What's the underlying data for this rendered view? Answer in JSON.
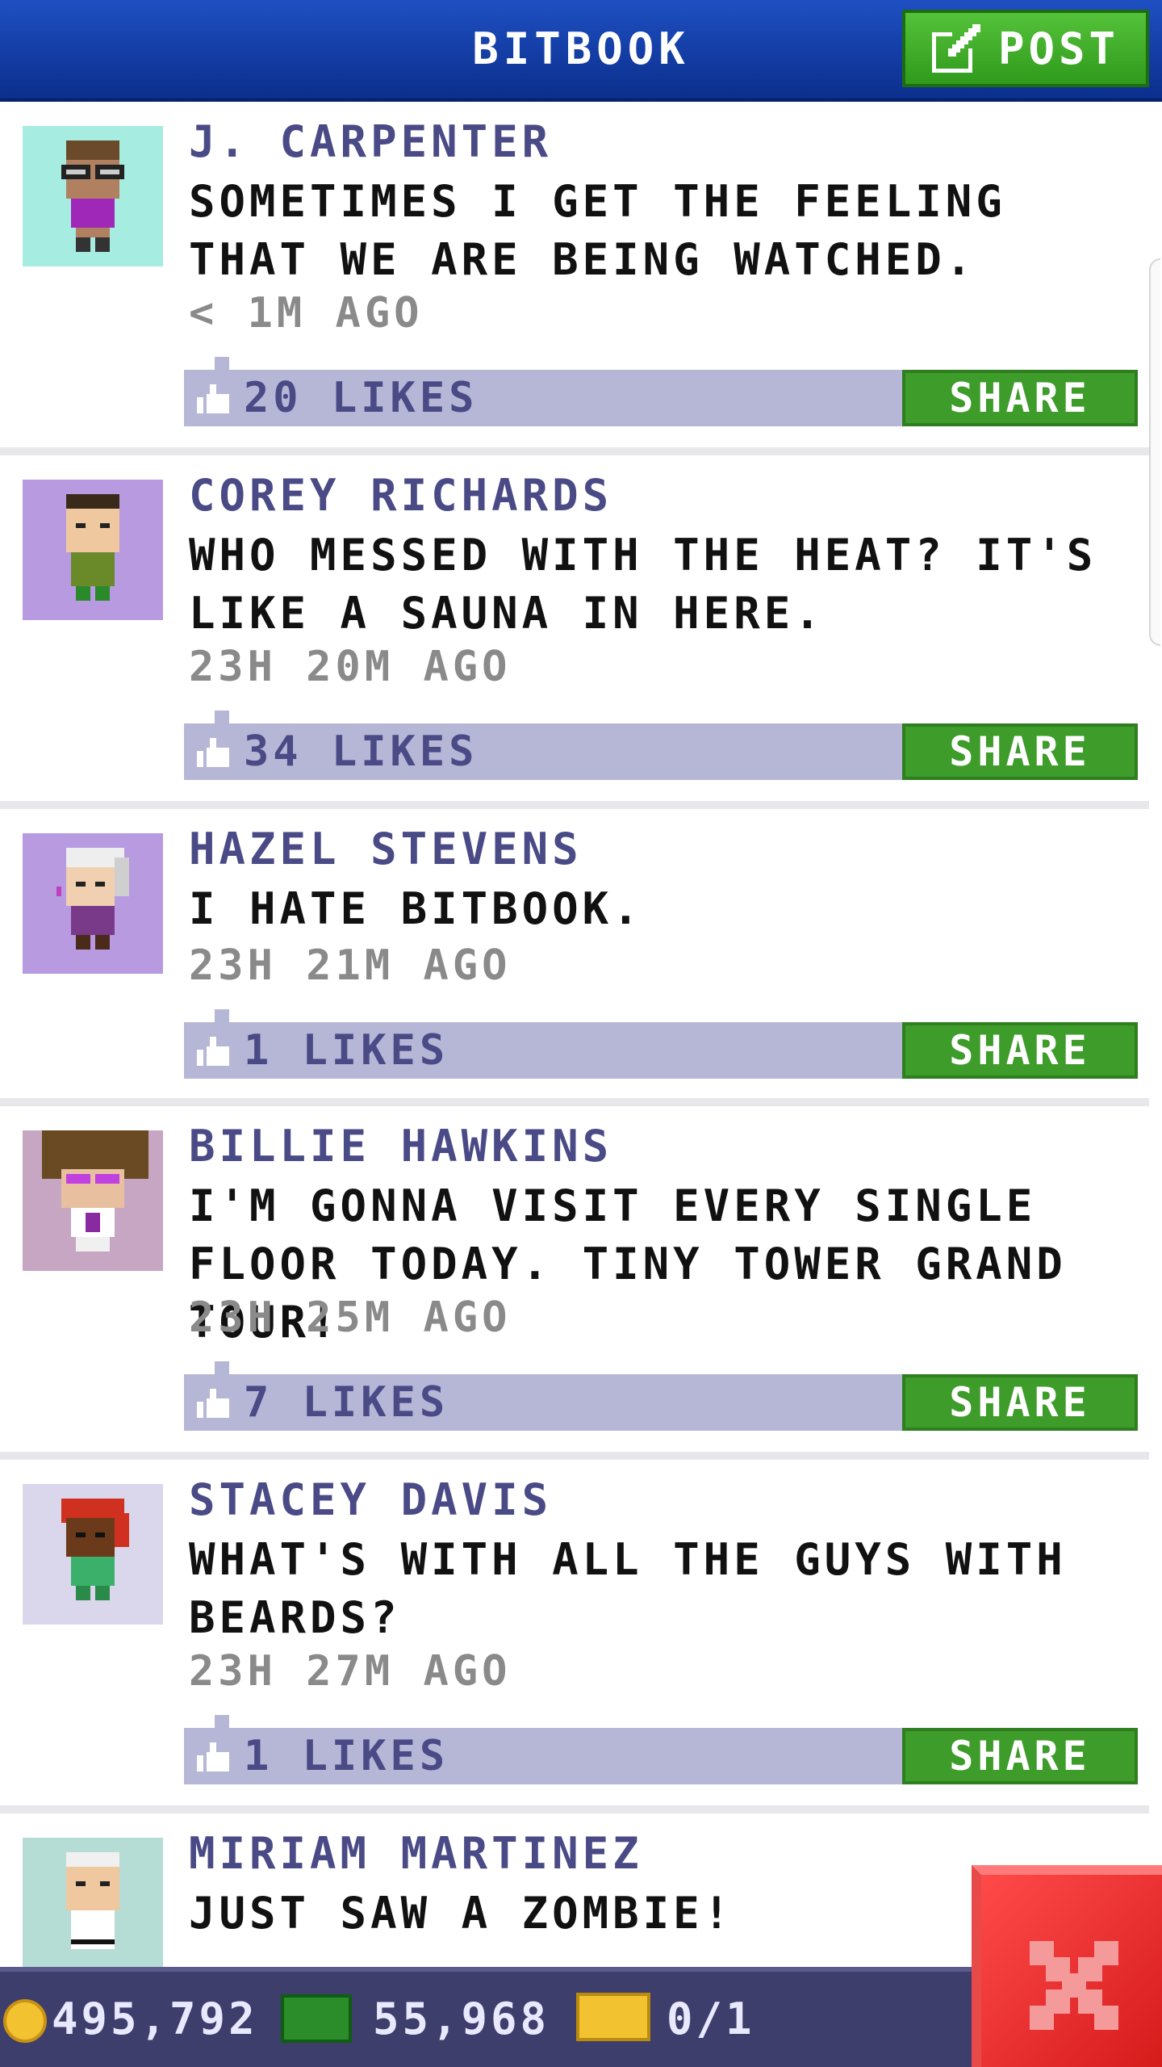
{
  "header": {
    "title": "BITBOOK",
    "post_label": "POST"
  },
  "posts": [
    {
      "name": "J. CARPENTER",
      "message": "SOMETIMES I GET THE FEELING THAT WE ARE BEING WATCHED.",
      "time": "< 1M AGO",
      "likes": "20 LIKES",
      "share": "SHARE",
      "avatar_bg": "#a6ece0"
    },
    {
      "name": "COREY RICHARDS",
      "message": "WHO MESSED WITH THE HEAT? IT'S LIKE A SAUNA IN HERE.",
      "time": "23H 20M AGO",
      "likes": "34 LIKES",
      "share": "SHARE",
      "avatar_bg": "#b89ae0"
    },
    {
      "name": "HAZEL STEVENS",
      "message": "I HATE BITBOOK.",
      "time": "23H 21M AGO",
      "likes": "1 LIKES",
      "share": "SHARE",
      "avatar_bg": "#b89ae0"
    },
    {
      "name": "BILLIE HAWKINS",
      "message": "I'M GONNA VISIT EVERY SINGLE FLOOR TODAY. TINY TOWER GRAND TOUR!",
      "time": "23H 25M AGO",
      "likes": "7 LIKES",
      "share": "SHARE",
      "avatar_bg": "#c6a6c2"
    },
    {
      "name": "STACEY DAVIS",
      "message": "WHAT'S WITH ALL THE GUYS WITH BEARDS?",
      "time": "23H 27M AGO",
      "likes": "1 LIKES",
      "share": "SHARE",
      "avatar_bg": "#dad6ec"
    },
    {
      "name": "MIRIAM MARTINEZ",
      "message": "JUST SAW A ZOMBIE!",
      "avatar_bg": "#b6dcd6"
    }
  ],
  "status": {
    "coins": "495,792",
    "bux": "55,968",
    "vip": "0/1"
  },
  "colors": {
    "header": "#1e4fc2",
    "post_button": "#3e9c2a",
    "share_button": "#3e9c2a",
    "likes_bar": "#b6b6d6",
    "close_button": "#e02626"
  },
  "icons": {
    "post": "edit-icon",
    "like": "thumbs-up-icon",
    "close": "close-icon",
    "coin": "coin-icon",
    "bux": "bux-icon",
    "vip": "vip-ticket-icon"
  }
}
